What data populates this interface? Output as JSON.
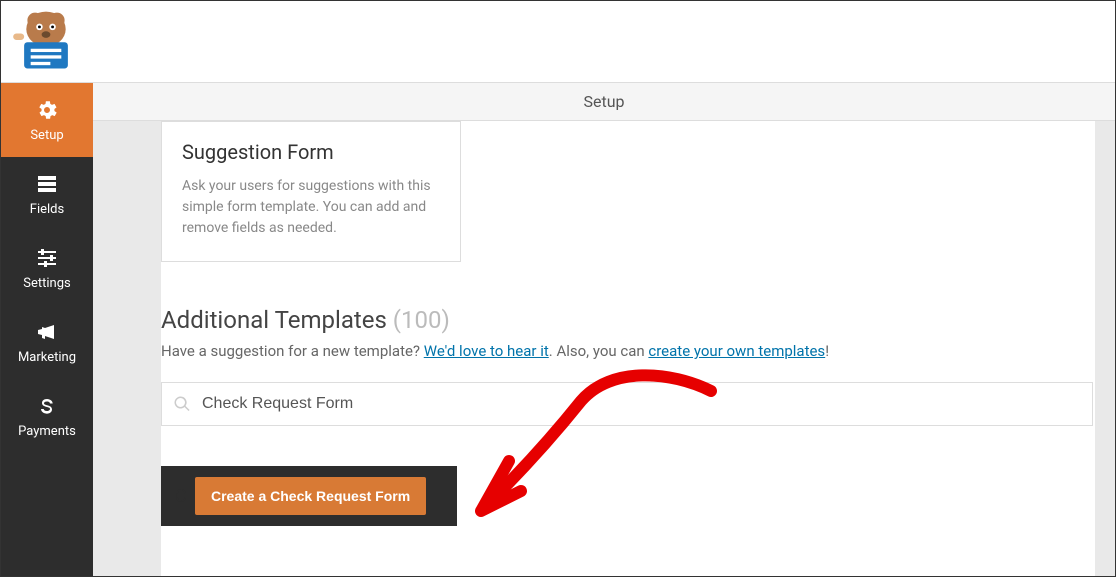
{
  "sidebar": {
    "items": [
      {
        "label": "Setup"
      },
      {
        "label": "Fields"
      },
      {
        "label": "Settings"
      },
      {
        "label": "Marketing"
      },
      {
        "label": "Payments"
      }
    ]
  },
  "header": {
    "title": "Setup"
  },
  "card": {
    "title": "Suggestion Form",
    "desc": "Ask your users for suggestions with this simple form template. You can add and remove fields as needed."
  },
  "section": {
    "title": "Additional Templates",
    "count": "(100)",
    "suggest_prefix": "Have a suggestion for a new template? ",
    "suggest_link1": "We'd love to hear it",
    "suggest_mid": ". Also, you can ",
    "suggest_link2": "create your own templates",
    "suggest_suffix": "!"
  },
  "search": {
    "value": "Check Request Form"
  },
  "result": {
    "hidden_label": "C",
    "button": "Create a Check Request Form"
  }
}
